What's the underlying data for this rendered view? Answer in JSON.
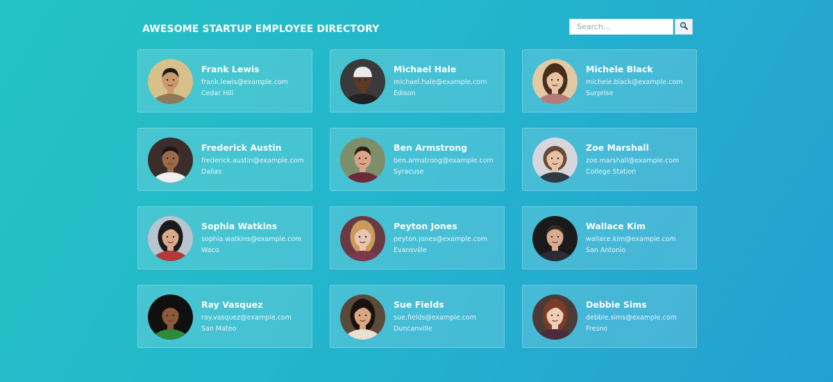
{
  "header": {
    "title": "AWESOME STARTUP EMPLOYEE DIRECTORY",
    "search_placeholder": "Search...",
    "search_icon": "magnifier-icon"
  },
  "employees": [
    {
      "name": "Frank Lewis",
      "email": "frank.lewis@example.com",
      "city": "Cedar Hill"
    },
    {
      "name": "Michael Hale",
      "email": "michael.hale@example.com",
      "city": "Edison"
    },
    {
      "name": "Michele Black",
      "email": "michele.black@example.com",
      "city": "Surprise"
    },
    {
      "name": "Frederick Austin",
      "email": "frederick.austin@example.com",
      "city": "Dallas"
    },
    {
      "name": "Ben Armstrong",
      "email": "ben.armstrong@example.com",
      "city": "Syracuse"
    },
    {
      "name": "Zoe Marshall",
      "email": "zoe.marshall@example.com",
      "city": "College Station"
    },
    {
      "name": "Sophia Watkins",
      "email": "sophia.watkins@example.com",
      "city": "Waco"
    },
    {
      "name": "Peyton Jones",
      "email": "peyton.jones@example.com",
      "city": "Evansville"
    },
    {
      "name": "Wallace Kim",
      "email": "wallace.kim@example.com",
      "city": "San Antonio"
    },
    {
      "name": "Ray Vasquez",
      "email": "ray.vasquez@example.com",
      "city": "San Mateo"
    },
    {
      "name": "Sue Fields",
      "email": "sue.fields@example.com",
      "city": "Duncanville"
    },
    {
      "name": "Debbie Sims",
      "email": "debbie.sims@example.com",
      "city": "Fresno"
    }
  ],
  "colors": {
    "background_start": "#24c3c3",
    "background_end": "#249fd2",
    "card_background": "rgba(255,255,255,0.16)"
  }
}
